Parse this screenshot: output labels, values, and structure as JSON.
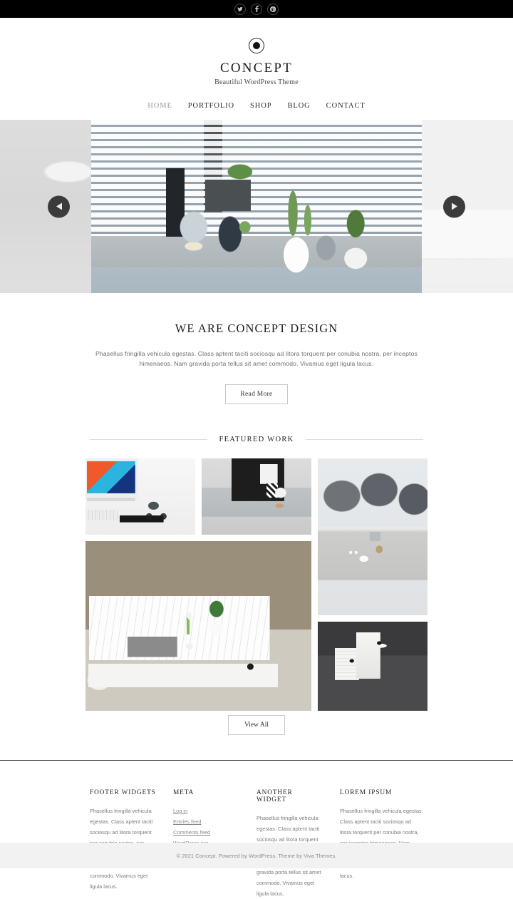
{
  "topbar": {
    "social": [
      {
        "name": "twitter-icon",
        "glyph": "t"
      },
      {
        "name": "facebook-icon",
        "glyph": "f"
      },
      {
        "name": "pinterest-icon",
        "glyph": "p"
      }
    ]
  },
  "header": {
    "logo_icon": "circle-dot-logo-icon",
    "title": "CONCEPT",
    "tagline": "Beautiful WordPress Theme"
  },
  "nav": {
    "items": [
      {
        "label": "HOME",
        "active": true
      },
      {
        "label": "PORTFOLIO",
        "active": false
      },
      {
        "label": "SHOP",
        "active": false
      },
      {
        "label": "BLOG",
        "active": false
      },
      {
        "label": "CONTACT",
        "active": false
      }
    ]
  },
  "slider": {
    "prev_icon": "chevron-left-icon",
    "next_icon": "chevron-right-icon",
    "slides": [
      {
        "alt": "faded previous slide"
      },
      {
        "alt": "potted plants and cactus on window sill with blinds"
      },
      {
        "alt": "imac with colorful screen and keyboard"
      }
    ]
  },
  "intro": {
    "title": "WE ARE CONCEPT DESIGN",
    "text": "Phasellus fringilla vehicula egestas. Class aptent taciti sociosqu ad litora torquent per conubia nostra, per inceptos himenaeos. Nam gravida porta tellus sit amet commodo. Vivamus eget ligula lacus.",
    "button_label": "Read More"
  },
  "featured": {
    "heading": "FEATURED WORK",
    "tiles": [
      {
        "alt": "desk with imac, mug and glasses"
      },
      {
        "alt": "ampersand sign with patterned mug"
      },
      {
        "alt": "grey cushions with coffee cup"
      },
      {
        "alt": "white pallet table with plant and book"
      },
      {
        "alt": "two white tin containers"
      }
    ],
    "view_all_label": "View All"
  },
  "footer": {
    "columns": [
      {
        "title": "FOOTER WIDGETS",
        "type": "text",
        "text": "Phasellus fringilla vehicula egestas. Class aptent taciti sociosqu ad litora torquent per conubia nostra, per inceptos himenaeos. Nam gravida porta tellus sit amet commodo. Vivamus eget ligula lacus."
      },
      {
        "title": "META",
        "type": "links",
        "links": [
          "Log in",
          "Entries feed",
          "Comments feed",
          "WordPress.org"
        ]
      },
      {
        "title": "ANOTHER WIDGET",
        "type": "text",
        "text": "Phasellus fringilla vehicula egestas. Class aptent taciti sociosqu ad litora torquent per conubia nostra, per inceptos himenaeos. Nam gravida porta tellus sit amet commodo. Vivamus eget ligula lacus."
      },
      {
        "title": "LOREM IPSUM",
        "type": "text",
        "text": "Phasellus fringilla vehicula egestas. Class aptent taciti sociosqu ad litora torquent per conubia nostra, per inceptos himenaeos. Nam gravida porta tellus sit amet commodo. Vivamus eget ligula lacus."
      }
    ]
  },
  "bottombar": {
    "copyright": "© 2021 Concept. Powered by WordPress. Theme by Viva Themes."
  },
  "colors": {
    "topbar_bg": "#000000",
    "page_bg": "#ffffff",
    "bottombar_bg": "#f2f2f2",
    "arrow_bg": "#3b3b3b",
    "text_dark": "#1c1c1c",
    "text_muted": "#7b7b7b"
  }
}
